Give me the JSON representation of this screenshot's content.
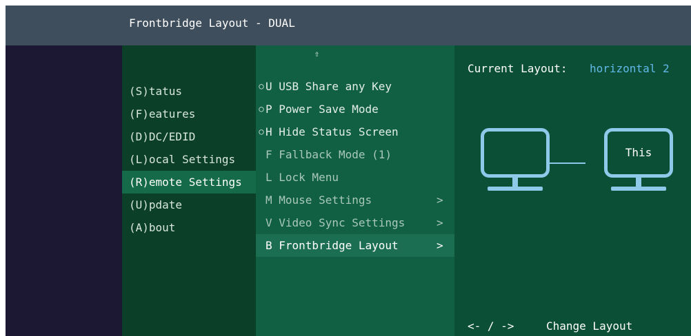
{
  "window": {
    "title": "Frontbridge Layout - DUAL"
  },
  "menu": {
    "items": [
      {
        "label": "(S)tatus"
      },
      {
        "label": "(F)eatures"
      },
      {
        "label": "(D)DC/EDID"
      },
      {
        "label": "(L)ocal  Settings"
      },
      {
        "label": "(R)emote Settings",
        "selected": true
      },
      {
        "label": "(U)pdate"
      },
      {
        "label": "(A)bout"
      }
    ]
  },
  "options": {
    "scroll_up_glyph": "⇧",
    "items": [
      {
        "bullet": "○",
        "label": "U USB Share any Key"
      },
      {
        "bullet": "○",
        "label": "P Power Save Mode"
      },
      {
        "bullet": "○",
        "label": "H Hide Status Screen"
      },
      {
        "bullet": "",
        "label": "F Fallback Mode (1)"
      },
      {
        "bullet": "",
        "label": "L Lock Menu"
      },
      {
        "bullet": "",
        "label": "M Mouse Settings",
        "chevron": ">"
      },
      {
        "bullet": "",
        "label": "V Video Sync Settings",
        "chevron": ">"
      },
      {
        "bullet": "",
        "label": "B Frontbridge Layout",
        "chevron": ">",
        "selected": true
      }
    ]
  },
  "layout_panel": {
    "current_label": "Current Layout:",
    "current_value": "horizontal 2",
    "monitors": [
      {
        "label": ""
      },
      {
        "label": "This"
      }
    ],
    "hint_keys": "<- / ->",
    "hint_text": "Change Layout"
  },
  "colors": {
    "title_bar": "#3f4e5c",
    "left_strip": "#1c1733",
    "menu_bg": "#0b3f27",
    "options_bg": "#116044",
    "layout_bg": "#0c4f37",
    "accent_value": "#62b8e8",
    "monitor_outline": "#8ec9ea"
  }
}
